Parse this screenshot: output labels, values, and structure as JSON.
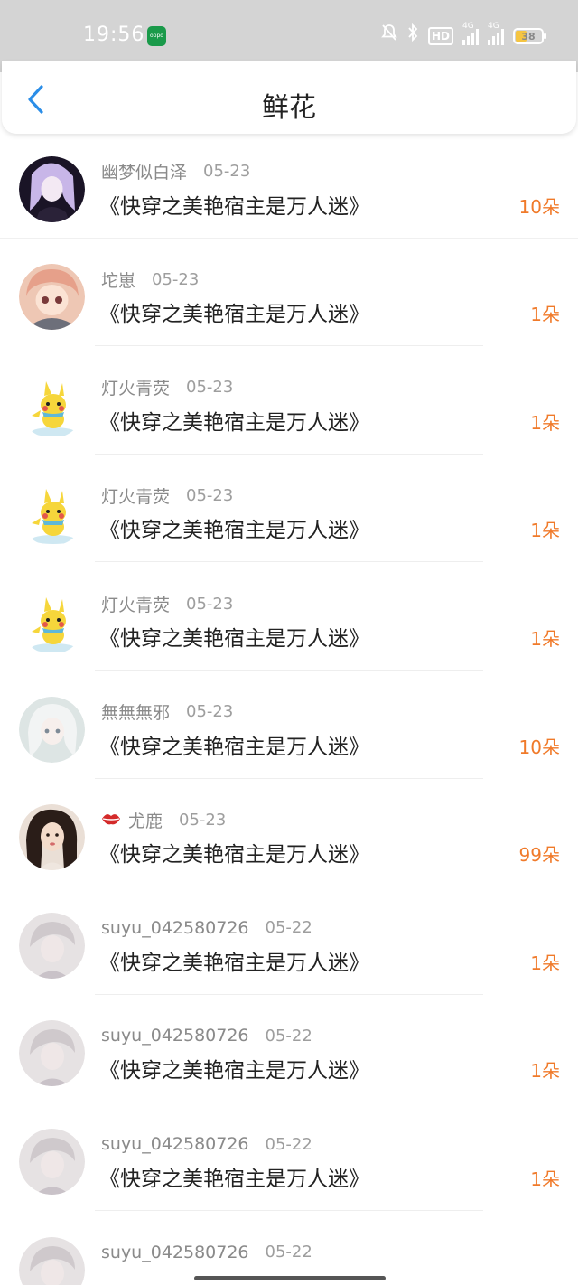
{
  "status_bar": {
    "time": "19:56",
    "brand_badge": "oppo",
    "hd_label": "HD",
    "net1": "4G",
    "net2": "4G",
    "battery": "38"
  },
  "header": {
    "title": "鲜花",
    "back_icon": "chevron-left-icon"
  },
  "colors": {
    "accent": "#f07a2a",
    "back_arrow": "#2b8ee8",
    "status_bar_bg": "#d4d4d4"
  },
  "rows": [
    {
      "user": "",
      "date": "",
      "book": "《快穿之美艳宿主是万人迷》",
      "count": "99朵",
      "avatar": "green-avatar"
    },
    {
      "user": "幽梦似白泽",
      "date": "05-23",
      "book": "《快穿之美艳宿主是万人迷》",
      "count": "10朵",
      "avatar": "purple-hair-avatar"
    },
    {
      "user": "坨崽",
      "date": "05-23",
      "book": "《快穿之美艳宿主是万人迷》",
      "count": "1朵",
      "avatar": "pink-hair-avatar"
    },
    {
      "user": "灯火青荧",
      "date": "05-23",
      "book": "《快穿之美艳宿主是万人迷》",
      "count": "1朵",
      "avatar": "pikachu-avatar"
    },
    {
      "user": "灯火青荧",
      "date": "05-23",
      "book": "《快穿之美艳宿主是万人迷》",
      "count": "1朵",
      "avatar": "pikachu-avatar"
    },
    {
      "user": "灯火青荧",
      "date": "05-23",
      "book": "《快穿之美艳宿主是万人迷》",
      "count": "1朵",
      "avatar": "pikachu-avatar"
    },
    {
      "user": "無無無邪",
      "date": "05-23",
      "book": "《快穿之美艳宿主是万人迷》",
      "count": "10朵",
      "avatar": "white-hair-avatar"
    },
    {
      "user": "尤鹿",
      "date": "05-23",
      "book": "《快穿之美艳宿主是万人迷》",
      "count": "99朵",
      "avatar": "girl-photo-avatar",
      "badge": "lips-icon"
    },
    {
      "user": "suyu_042580726",
      "date": "05-22",
      "book": "《快穿之美艳宿主是万人迷》",
      "count": "1朵",
      "avatar": "pale-boy-avatar"
    },
    {
      "user": "suyu_042580726",
      "date": "05-22",
      "book": "《快穿之美艳宿主是万人迷》",
      "count": "1朵",
      "avatar": "pale-boy-avatar"
    },
    {
      "user": "suyu_042580726",
      "date": "05-22",
      "book": "《快穿之美艳宿主是万人迷》",
      "count": "1朵",
      "avatar": "pale-boy-avatar"
    },
    {
      "user": "suyu_042580726",
      "date": "05-22",
      "book": "",
      "count": "",
      "avatar": "pale-boy-avatar"
    }
  ]
}
